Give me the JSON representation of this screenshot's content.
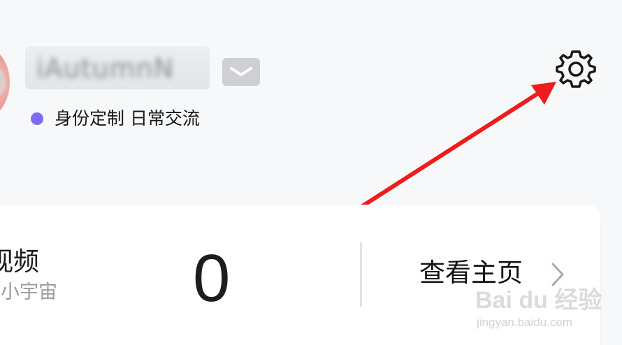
{
  "profile": {
    "username": "iAutumnN",
    "status_text": "身份定制 日常交流",
    "status_color": "#7b6cf6"
  },
  "header": {
    "settings_icon": "gear-icon",
    "annotation_color": "#ee1c1c"
  },
  "card": {
    "video_label": "视频",
    "video_sublabel": "作小宇宙",
    "video_count": "0",
    "homepage_label": "查看主页",
    "homepage_icon": "chevron-right-icon"
  },
  "watermark": {
    "main": "Bai du 经验",
    "sub": "jingyan.baidu.com"
  }
}
